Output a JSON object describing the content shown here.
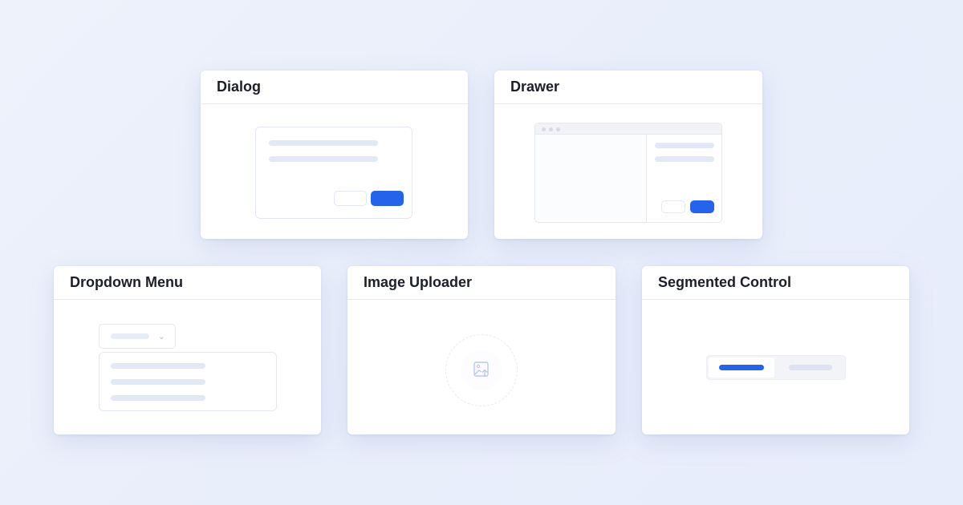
{
  "cards": {
    "dialog": {
      "title": "Dialog"
    },
    "drawer": {
      "title": "Drawer"
    },
    "dropdown": {
      "title": "Dropdown Menu"
    },
    "uploader": {
      "title": "Image Uploader"
    },
    "segmented": {
      "title": "Segmented Control"
    }
  },
  "icons": {
    "upload": "image-upload-icon",
    "chevron": "chevron-down-icon"
  },
  "colors": {
    "accent": "#2563eb",
    "placeholder": "#e2e8f6",
    "background": "#eef2fb"
  }
}
